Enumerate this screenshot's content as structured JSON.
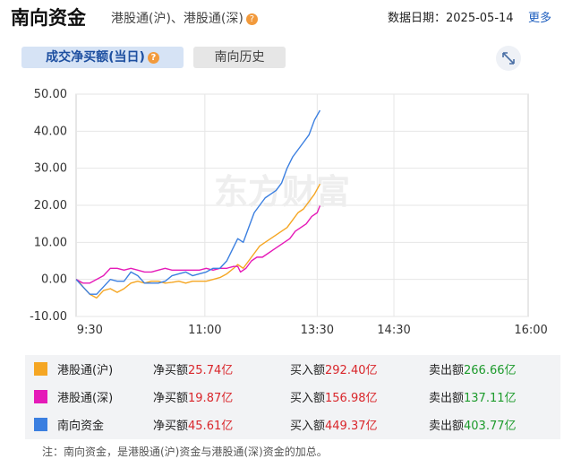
{
  "header": {
    "title": "南向资金",
    "subtitle": "港股通(沪)、港股通(深)",
    "help_glyph": "?",
    "date_label": "数据日期：",
    "date_value": "2025-05-14",
    "more_label": "更多"
  },
  "tabs": [
    {
      "label": "成交净买额(当日)",
      "active": true
    },
    {
      "label": "南向历史",
      "active": false
    }
  ],
  "watermark": "东方财富",
  "chart_data": {
    "type": "line",
    "ylim": [
      -10,
      50
    ],
    "yticks": [
      "50.00",
      "40.00",
      "30.00",
      "20.00",
      "10.00",
      "0.00",
      "-10.00"
    ],
    "xticks": [
      "9:30",
      "11:00",
      "13:30",
      "14:30",
      "16:00"
    ],
    "grid": true,
    "series": [
      {
        "name": "港股通(沪)",
        "color": "#f5a623",
        "values": [
          [
            0,
            0
          ],
          [
            2,
            -0.5
          ],
          [
            5,
            -2
          ],
          [
            10,
            -4
          ],
          [
            15,
            -5
          ],
          [
            20,
            -3
          ],
          [
            25,
            -2.5
          ],
          [
            30,
            -3.5
          ],
          [
            35,
            -2.5
          ],
          [
            40,
            -1
          ],
          [
            45,
            -0.5
          ],
          [
            50,
            -1
          ],
          [
            55,
            -0.5
          ],
          [
            60,
            -0.5
          ],
          [
            65,
            -1
          ],
          [
            70,
            -0.8
          ],
          [
            75,
            -0.5
          ],
          [
            80,
            -1
          ],
          [
            85,
            -0.5
          ],
          [
            90,
            -0.5
          ],
          [
            95,
            -0.5
          ],
          [
            100,
            0
          ],
          [
            105,
            0.5
          ],
          [
            110,
            1.5
          ],
          [
            115,
            3
          ],
          [
            118,
            4
          ],
          [
            122,
            3
          ],
          [
            126,
            5
          ],
          [
            130,
            7
          ],
          [
            134,
            9
          ],
          [
            138,
            10
          ],
          [
            142,
            11
          ],
          [
            146,
            12
          ],
          [
            150,
            13
          ],
          [
            154,
            14
          ],
          [
            158,
            16
          ],
          [
            162,
            18
          ],
          [
            166,
            19
          ],
          [
            170,
            21
          ],
          [
            174,
            23
          ],
          [
            178,
            25.74
          ]
        ]
      },
      {
        "name": "港股通(深)",
        "color": "#e51ab8",
        "values": [
          [
            0,
            0
          ],
          [
            5,
            -1
          ],
          [
            10,
            -1
          ],
          [
            15,
            0
          ],
          [
            20,
            1
          ],
          [
            25,
            3
          ],
          [
            30,
            3
          ],
          [
            35,
            2.5
          ],
          [
            40,
            3
          ],
          [
            45,
            2.5
          ],
          [
            50,
            2
          ],
          [
            55,
            2
          ],
          [
            60,
            2.5
          ],
          [
            65,
            3
          ],
          [
            70,
            2.5
          ],
          [
            75,
            2.5
          ],
          [
            80,
            2.5
          ],
          [
            85,
            2.5
          ],
          [
            90,
            2.5
          ],
          [
            95,
            3
          ],
          [
            100,
            2.5
          ],
          [
            105,
            3
          ],
          [
            110,
            3
          ],
          [
            115,
            3.5
          ],
          [
            118,
            3.5
          ],
          [
            120,
            2
          ],
          [
            124,
            3
          ],
          [
            128,
            5
          ],
          [
            132,
            6
          ],
          [
            136,
            6
          ],
          [
            140,
            7
          ],
          [
            144,
            8
          ],
          [
            148,
            9
          ],
          [
            152,
            10
          ],
          [
            156,
            11
          ],
          [
            160,
            13
          ],
          [
            164,
            14
          ],
          [
            168,
            15
          ],
          [
            172,
            17
          ],
          [
            176,
            18
          ],
          [
            178,
            19.87
          ]
        ]
      },
      {
        "name": "南向资金",
        "color": "#3b7fe0",
        "values": [
          [
            0,
            0
          ],
          [
            5,
            -2
          ],
          [
            10,
            -4
          ],
          [
            15,
            -4
          ],
          [
            20,
            -2
          ],
          [
            25,
            0
          ],
          [
            30,
            -0.5
          ],
          [
            35,
            -0.5
          ],
          [
            40,
            2
          ],
          [
            45,
            1
          ],
          [
            50,
            -1
          ],
          [
            55,
            -1
          ],
          [
            60,
            -1
          ],
          [
            65,
            -0.5
          ],
          [
            70,
            1
          ],
          [
            75,
            1.5
          ],
          [
            80,
            2
          ],
          [
            85,
            1
          ],
          [
            90,
            1.5
          ],
          [
            95,
            2
          ],
          [
            100,
            3
          ],
          [
            105,
            3
          ],
          [
            110,
            5
          ],
          [
            114,
            8
          ],
          [
            118,
            11
          ],
          [
            122,
            10
          ],
          [
            126,
            14
          ],
          [
            130,
            18
          ],
          [
            134,
            20
          ],
          [
            138,
            22
          ],
          [
            142,
            23
          ],
          [
            146,
            24
          ],
          [
            150,
            26
          ],
          [
            154,
            30
          ],
          [
            158,
            33
          ],
          [
            162,
            35
          ],
          [
            166,
            37
          ],
          [
            170,
            39
          ],
          [
            174,
            43
          ],
          [
            178,
            45.61
          ]
        ]
      }
    ]
  },
  "legend": {
    "rows": [
      {
        "name": "港股通(沪)",
        "color": "#f5a623",
        "net_label": "净买额",
        "net_value": "25.74亿",
        "buy_label": "买入额",
        "buy_value": "292.40亿",
        "sell_label": "卖出额",
        "sell_value": "266.66亿"
      },
      {
        "name": "港股通(深)",
        "color": "#e51ab8",
        "net_label": "净买额",
        "net_value": "19.87亿",
        "buy_label": "买入额",
        "buy_value": "156.98亿",
        "sell_label": "卖出额",
        "sell_value": "137.11亿"
      },
      {
        "name": "南向资金",
        "color": "#3b7fe0",
        "net_label": "净买额",
        "net_value": "45.61亿",
        "buy_label": "买入额",
        "buy_value": "449.37亿",
        "sell_label": "卖出额",
        "sell_value": "403.77亿"
      }
    ]
  },
  "note": "注：南向资金，是港股通(沪)资金与港股通(深)资金的加总。",
  "icons": {
    "expand": "expand-icon",
    "help": "help-icon"
  }
}
